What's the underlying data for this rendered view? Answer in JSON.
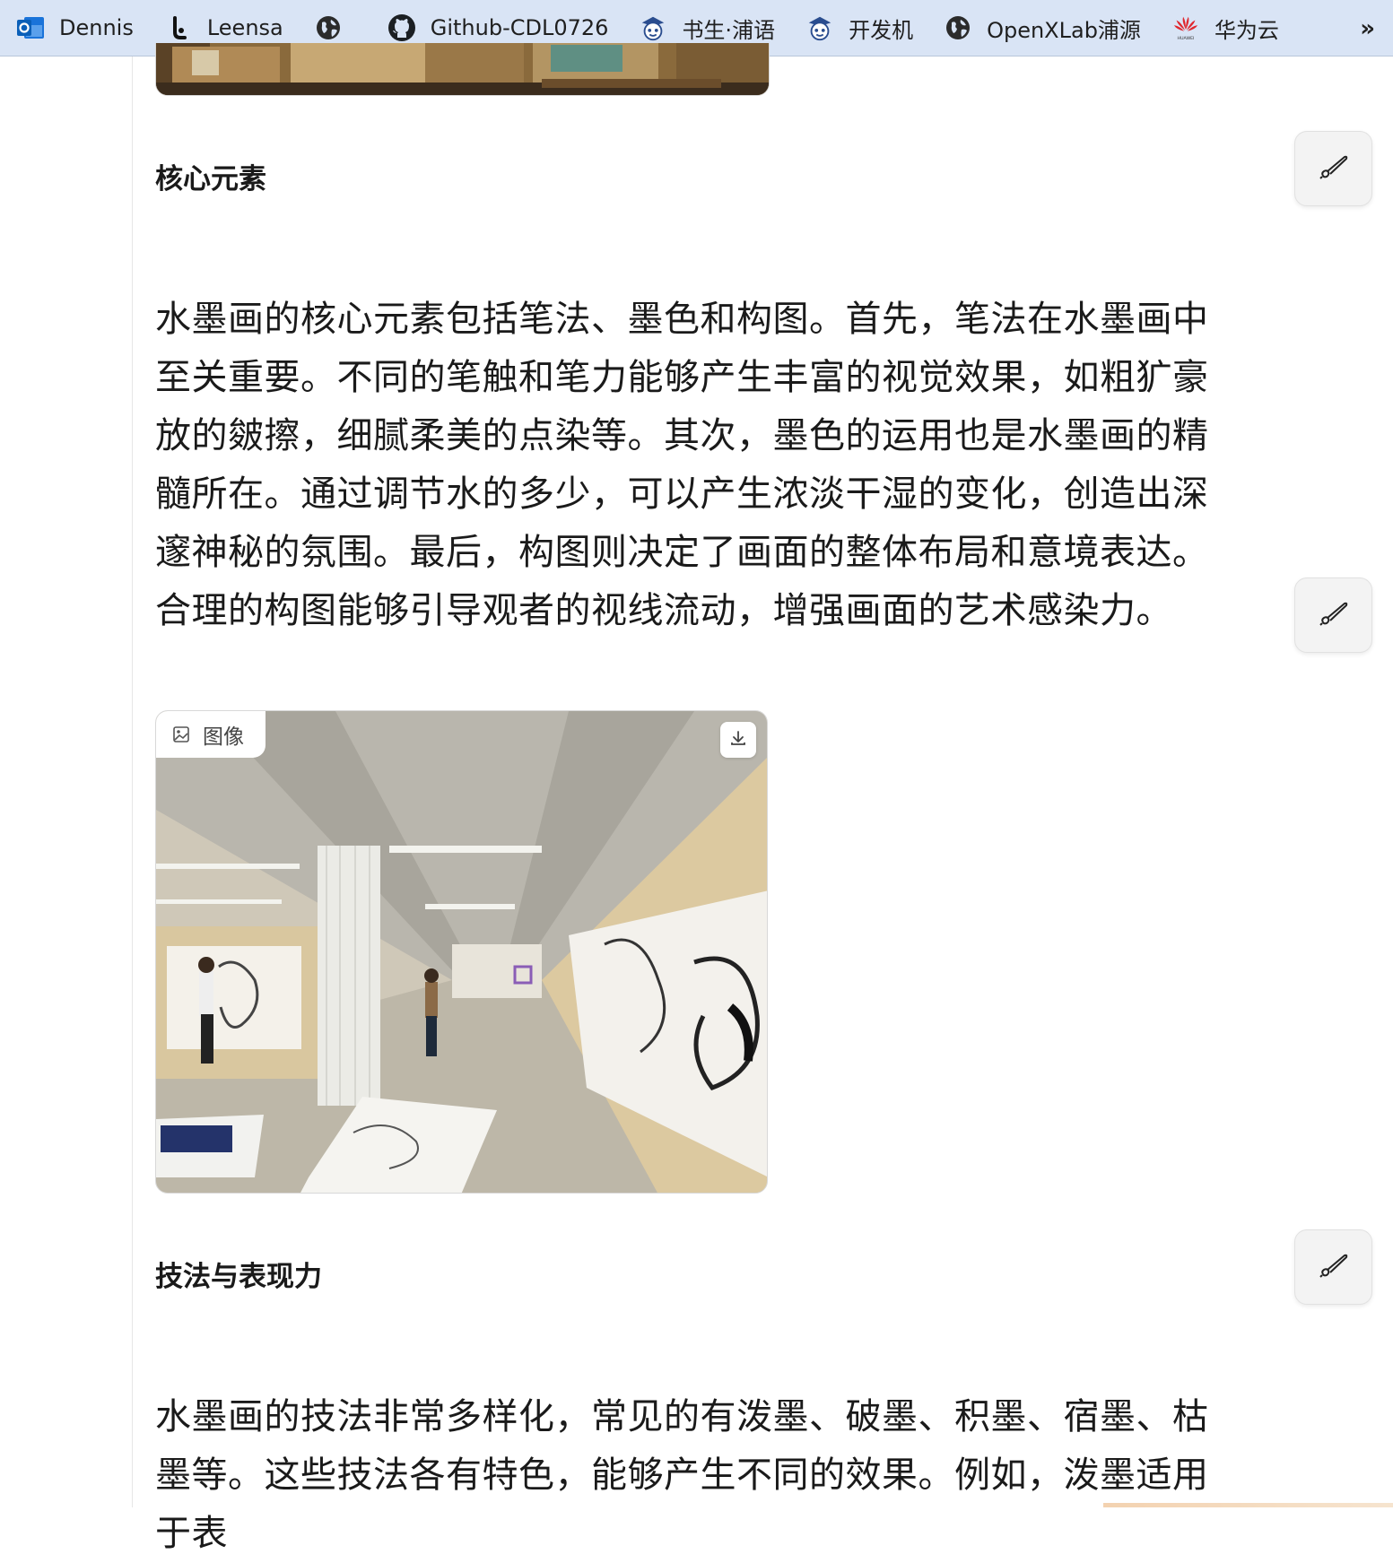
{
  "bookmarks": [
    {
      "label": "Dennis",
      "icon": "outlook-icon"
    },
    {
      "label": "Leensa",
      "icon": "leensa-icon"
    },
    {
      "label": "",
      "icon": "globe-icon"
    },
    {
      "label": "Github-CDL0726",
      "icon": "github-icon"
    },
    {
      "label": "书生·浦语",
      "icon": "robot-icon"
    },
    {
      "label": "开发机",
      "icon": "robot-icon"
    },
    {
      "label": "OpenXLab浦源",
      "icon": "globe-icon"
    },
    {
      "label": "华为云",
      "icon": "huawei-icon"
    }
  ],
  "bookmarks_more": "»",
  "sections": {
    "core": {
      "heading": "核心元素",
      "paragraph": "水墨画的核心元素包括笔法、墨色和构图。首先，笔法在水墨画中至关重要。不同的笔触和笔力能够产生丰富的视觉效果，如粗犷豪放的皴擦，细腻柔美的点染等。其次，墨色的运用也是水墨画的精髓所在。通过调节水的多少，可以产生浓淡干湿的变化，创造出深邃神秘的氛围。最后，构图则决定了画面的整体布局和意境表达。合理的构图能够引导观者的视线流动，增强画面的艺术感染力。"
    },
    "image": {
      "label": "图像",
      "download_icon": "download-icon"
    },
    "technique": {
      "heading": "技法与表现力",
      "paragraph": "水墨画的技法非常多样化，常见的有泼墨、破墨、积墨、宿墨、枯墨等。这些技法各有特色，能够产生不同的效果。例如，泼墨适用于表"
    }
  },
  "edit_icon": "brush-icon"
}
